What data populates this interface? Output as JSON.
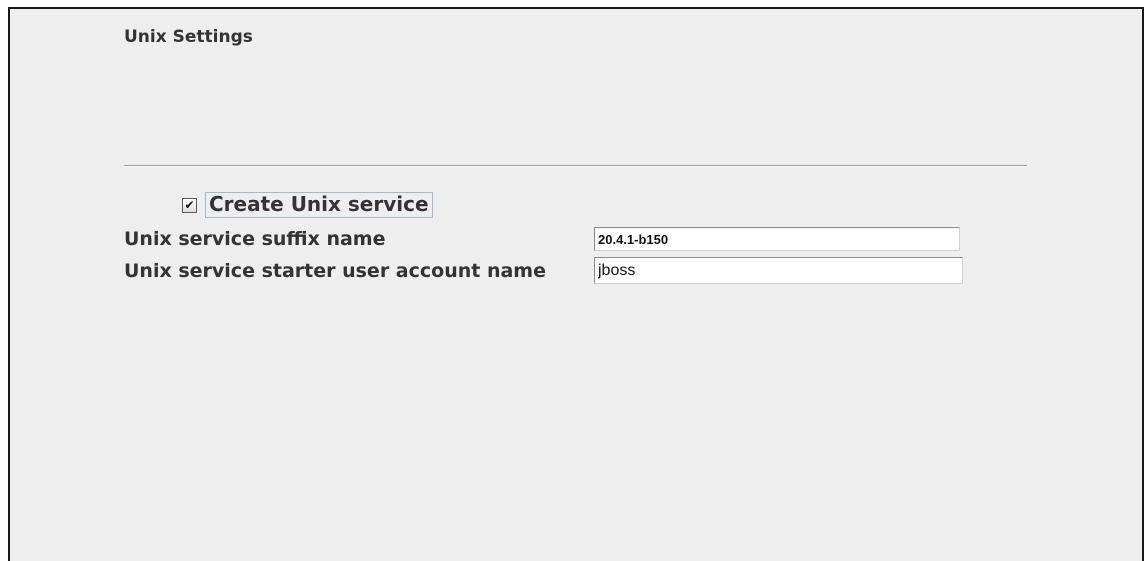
{
  "section": {
    "title": "Unix Settings"
  },
  "create_service": {
    "label": "Create Unix service",
    "checked": true,
    "check_glyph": "✔"
  },
  "fields": {
    "suffix": {
      "label": "Unix service suffix name",
      "value": "20.4.1-b150"
    },
    "starter": {
      "label": "Unix service starter user account name",
      "value": "jboss"
    }
  }
}
